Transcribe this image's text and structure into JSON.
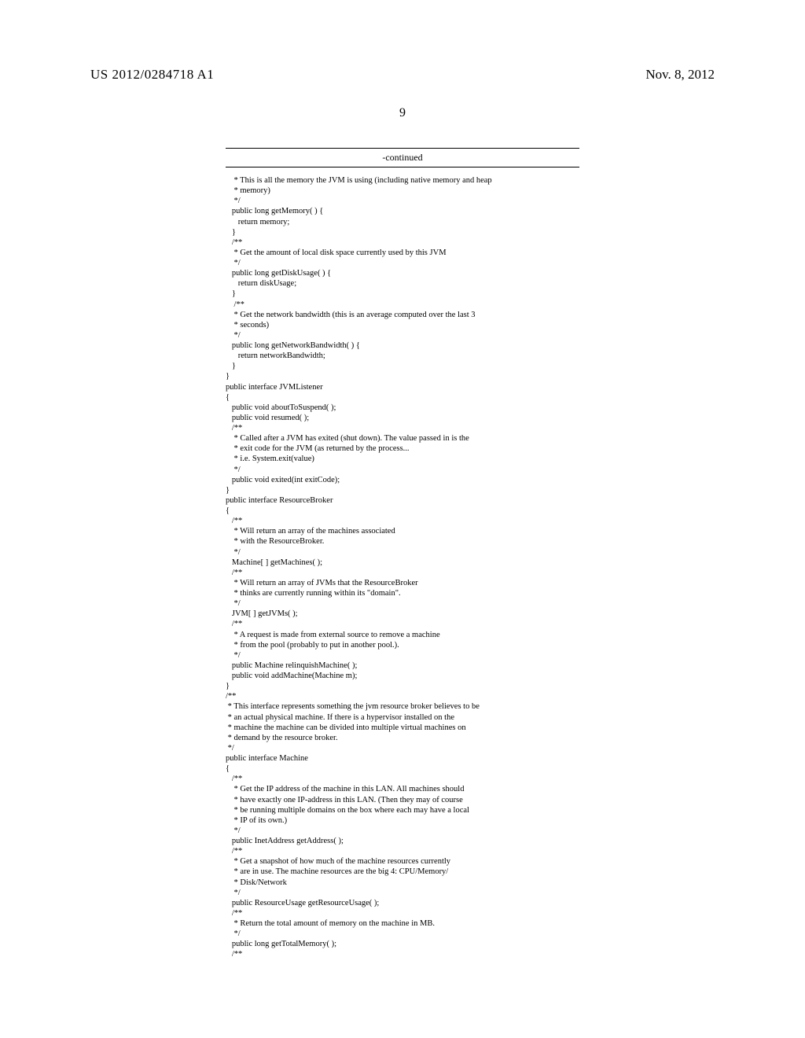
{
  "header": {
    "publication_number": "US 2012/0284718 A1",
    "publication_date": "Nov. 8, 2012"
  },
  "page_number": "9",
  "code_section": {
    "continued_label": "-continued",
    "code": "    * This is all the memory the JVM is using (including native memory and heap\n    * memory)\n    */\n   public long getMemory( ) {\n      return memory;\n   }\n   /**\n    * Get the amount of local disk space currently used by this JVM\n    */\n   public long getDiskUsage( ) {\n      return diskUsage;\n   }\n    /**\n    * Get the network bandwidth (this is an average computed over the last 3\n    * seconds)\n    */\n   public long getNetworkBandwidth( ) {\n      return networkBandwidth;\n   }\n}\npublic interface JVMListener\n{\n   public void aboutToSuspend( );\n   public void resumed( );\n   /**\n    * Called after a JVM has exited (shut down). The value passed in is the\n    * exit code for the JVM (as returned by the process...\n    * i.e. System.exit(value)\n    */\n   public void exited(int exitCode);\n}\npublic interface ResourceBroker\n{\n   /**\n    * Will return an array of the machines associated\n    * with the ResourceBroker.\n    */\n   Machine[ ] getMachines( );\n   /**\n    * Will return an array of JVMs that the ResourceBroker\n    * thinks are currently running within its \"domain\".\n    */\n   JVM[ ] getJVMs( );\n   /**\n    * A request is made from external source to remove a machine\n    * from the pool (probably to put in another pool.).\n    */\n   public Machine relinquishMachine( );\n   public void addMachine(Machine m);\n}\n/**\n * This interface represents something the jvm resource broker believes to be\n * an actual physical machine. If there is a hypervisor installed on the\n * machine the machine can be divided into multiple virtual machines on\n * demand by the resource broker.\n */\npublic interface Machine\n{\n   /**\n    * Get the IP address of the machine in this LAN. All machines should\n    * have exactly one IP-address in this LAN. (Then they may of course\n    * be running multiple domains on the box where each may have a local\n    * IP of its own.)\n    */\n   public InetAddress getAddress( );\n   /**\n    * Get a snapshot of how much of the machine resources currently\n    * are in use. The machine resources are the big 4: CPU/Memory/\n    * Disk/Network\n    */\n   public ResourceUsage getResourceUsage( );\n   /**\n    * Return the total amount of memory on the machine in MB.\n    */\n   public long getTotalMemory( );\n   /**"
  }
}
